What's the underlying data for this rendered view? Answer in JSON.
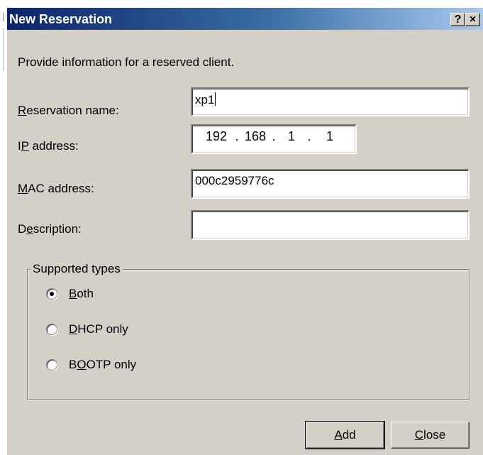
{
  "dialog": {
    "title": "New Reservation",
    "help_glyph": "?",
    "close_glyph": "×"
  },
  "intro": "Provide information for a reserved client.",
  "fields": {
    "reservation_name": {
      "label_key": "R",
      "label_rest": "eservation name:",
      "value": "xp1"
    },
    "ip_address": {
      "label_pre": "I",
      "label_key": "P",
      "label_rest": " address:",
      "octets": [
        "192",
        "168",
        "1",
        "1"
      ]
    },
    "mac_address": {
      "label_key": "M",
      "label_rest": "AC address:",
      "value": "000c2959776c"
    },
    "description": {
      "label_pre": "D",
      "label_key": "e",
      "label_rest": "scription:",
      "value": ""
    }
  },
  "supported_types": {
    "legend": "Supported types",
    "options": [
      {
        "key": "B",
        "rest": "oth",
        "pre": "",
        "selected": true
      },
      {
        "key": "D",
        "rest": "HCP only",
        "pre": "",
        "selected": false
      },
      {
        "pre": "B",
        "key": "O",
        "rest": "OTP only",
        "selected": false
      }
    ]
  },
  "buttons": {
    "add": {
      "key": "A",
      "rest": "dd"
    },
    "close": {
      "key": "C",
      "rest": "lose"
    }
  }
}
